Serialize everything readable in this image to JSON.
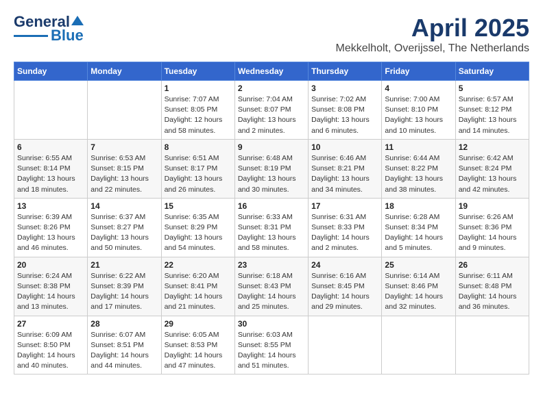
{
  "logo": {
    "line1": "General",
    "line2": "Blue"
  },
  "title": "April 2025",
  "subtitle": "Mekkelholt, Overijssel, The Netherlands",
  "weekdays": [
    "Sunday",
    "Monday",
    "Tuesday",
    "Wednesday",
    "Thursday",
    "Friday",
    "Saturday"
  ],
  "weeks": [
    [
      {
        "day": "",
        "detail": ""
      },
      {
        "day": "",
        "detail": ""
      },
      {
        "day": "1",
        "detail": "Sunrise: 7:07 AM\nSunset: 8:05 PM\nDaylight: 12 hours\nand 58 minutes."
      },
      {
        "day": "2",
        "detail": "Sunrise: 7:04 AM\nSunset: 8:07 PM\nDaylight: 13 hours\nand 2 minutes."
      },
      {
        "day": "3",
        "detail": "Sunrise: 7:02 AM\nSunset: 8:08 PM\nDaylight: 13 hours\nand 6 minutes."
      },
      {
        "day": "4",
        "detail": "Sunrise: 7:00 AM\nSunset: 8:10 PM\nDaylight: 13 hours\nand 10 minutes."
      },
      {
        "day": "5",
        "detail": "Sunrise: 6:57 AM\nSunset: 8:12 PM\nDaylight: 13 hours\nand 14 minutes."
      }
    ],
    [
      {
        "day": "6",
        "detail": "Sunrise: 6:55 AM\nSunset: 8:14 PM\nDaylight: 13 hours\nand 18 minutes."
      },
      {
        "day": "7",
        "detail": "Sunrise: 6:53 AM\nSunset: 8:15 PM\nDaylight: 13 hours\nand 22 minutes."
      },
      {
        "day": "8",
        "detail": "Sunrise: 6:51 AM\nSunset: 8:17 PM\nDaylight: 13 hours\nand 26 minutes."
      },
      {
        "day": "9",
        "detail": "Sunrise: 6:48 AM\nSunset: 8:19 PM\nDaylight: 13 hours\nand 30 minutes."
      },
      {
        "day": "10",
        "detail": "Sunrise: 6:46 AM\nSunset: 8:21 PM\nDaylight: 13 hours\nand 34 minutes."
      },
      {
        "day": "11",
        "detail": "Sunrise: 6:44 AM\nSunset: 8:22 PM\nDaylight: 13 hours\nand 38 minutes."
      },
      {
        "day": "12",
        "detail": "Sunrise: 6:42 AM\nSunset: 8:24 PM\nDaylight: 13 hours\nand 42 minutes."
      }
    ],
    [
      {
        "day": "13",
        "detail": "Sunrise: 6:39 AM\nSunset: 8:26 PM\nDaylight: 13 hours\nand 46 minutes."
      },
      {
        "day": "14",
        "detail": "Sunrise: 6:37 AM\nSunset: 8:27 PM\nDaylight: 13 hours\nand 50 minutes."
      },
      {
        "day": "15",
        "detail": "Sunrise: 6:35 AM\nSunset: 8:29 PM\nDaylight: 13 hours\nand 54 minutes."
      },
      {
        "day": "16",
        "detail": "Sunrise: 6:33 AM\nSunset: 8:31 PM\nDaylight: 13 hours\nand 58 minutes."
      },
      {
        "day": "17",
        "detail": "Sunrise: 6:31 AM\nSunset: 8:33 PM\nDaylight: 14 hours\nand 2 minutes."
      },
      {
        "day": "18",
        "detail": "Sunrise: 6:28 AM\nSunset: 8:34 PM\nDaylight: 14 hours\nand 5 minutes."
      },
      {
        "day": "19",
        "detail": "Sunrise: 6:26 AM\nSunset: 8:36 PM\nDaylight: 14 hours\nand 9 minutes."
      }
    ],
    [
      {
        "day": "20",
        "detail": "Sunrise: 6:24 AM\nSunset: 8:38 PM\nDaylight: 14 hours\nand 13 minutes."
      },
      {
        "day": "21",
        "detail": "Sunrise: 6:22 AM\nSunset: 8:39 PM\nDaylight: 14 hours\nand 17 minutes."
      },
      {
        "day": "22",
        "detail": "Sunrise: 6:20 AM\nSunset: 8:41 PM\nDaylight: 14 hours\nand 21 minutes."
      },
      {
        "day": "23",
        "detail": "Sunrise: 6:18 AM\nSunset: 8:43 PM\nDaylight: 14 hours\nand 25 minutes."
      },
      {
        "day": "24",
        "detail": "Sunrise: 6:16 AM\nSunset: 8:45 PM\nDaylight: 14 hours\nand 29 minutes."
      },
      {
        "day": "25",
        "detail": "Sunrise: 6:14 AM\nSunset: 8:46 PM\nDaylight: 14 hours\nand 32 minutes."
      },
      {
        "day": "26",
        "detail": "Sunrise: 6:11 AM\nSunset: 8:48 PM\nDaylight: 14 hours\nand 36 minutes."
      }
    ],
    [
      {
        "day": "27",
        "detail": "Sunrise: 6:09 AM\nSunset: 8:50 PM\nDaylight: 14 hours\nand 40 minutes."
      },
      {
        "day": "28",
        "detail": "Sunrise: 6:07 AM\nSunset: 8:51 PM\nDaylight: 14 hours\nand 44 minutes."
      },
      {
        "day": "29",
        "detail": "Sunrise: 6:05 AM\nSunset: 8:53 PM\nDaylight: 14 hours\nand 47 minutes."
      },
      {
        "day": "30",
        "detail": "Sunrise: 6:03 AM\nSunset: 8:55 PM\nDaylight: 14 hours\nand 51 minutes."
      },
      {
        "day": "",
        "detail": ""
      },
      {
        "day": "",
        "detail": ""
      },
      {
        "day": "",
        "detail": ""
      }
    ]
  ]
}
